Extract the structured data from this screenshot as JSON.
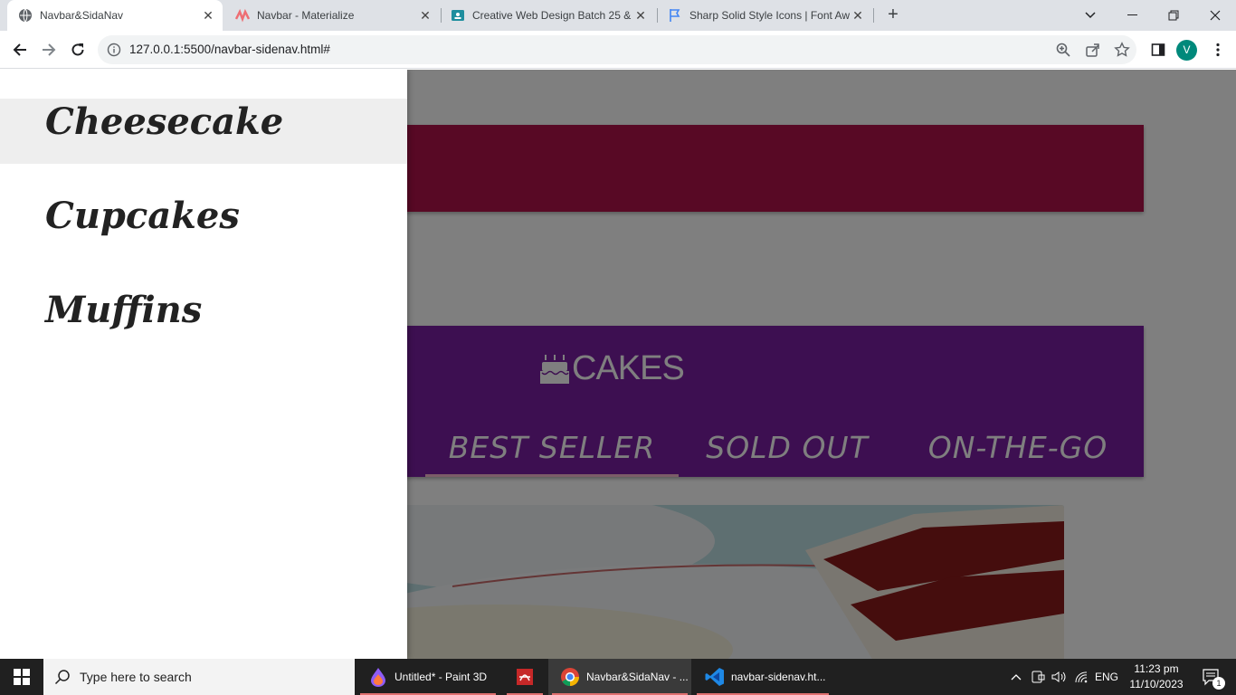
{
  "browser": {
    "tabs": [
      {
        "title": "Navbar&SidaNav",
        "favicon": "globe-icon",
        "active": true
      },
      {
        "title": "Navbar - Materialize",
        "favicon": "materialize-icon",
        "active": false
      },
      {
        "title": "Creative Web Design Batch 25 &",
        "favicon": "classroom-icon",
        "active": false
      },
      {
        "title": "Sharp Solid Style Icons | Font Aw",
        "favicon": "fontawesome-flag-icon",
        "active": false
      }
    ],
    "new_tab": "+",
    "url": "127.0.0.1:5500/navbar-sidenav.html#",
    "profile_initial": "V"
  },
  "page": {
    "brand": "CAKES",
    "brand_icon": "birthday-cake-icon",
    "nav_tabs": [
      {
        "label": "BEST SELLER",
        "active": true
      },
      {
        "label": "SOLD OUT",
        "active": false
      },
      {
        "label": "ON-THE-GO",
        "active": false
      }
    ],
    "colors": {
      "top_bar": "#b0124a",
      "nav_bar": "#7b1fa2",
      "overlay": "rgba(0,0,0,0.5)"
    }
  },
  "sidenav": {
    "items": [
      {
        "label": "Cheesecake",
        "hovered": true
      },
      {
        "label": "Cupcakes",
        "hovered": false
      },
      {
        "label": "Muffins",
        "hovered": false
      }
    ]
  },
  "taskbar": {
    "search_placeholder": "Type here to search",
    "apps": [
      {
        "label": "Untitled* - Paint 3D",
        "icon": "paint3d-icon"
      },
      {
        "label": "",
        "icon": "pdf-app-icon"
      },
      {
        "label": "Navbar&SidaNav - ...",
        "icon": "chrome-icon"
      },
      {
        "label": "navbar-sidenav.ht...",
        "icon": "vscode-icon"
      }
    ],
    "language": "ENG",
    "time": "11:23 pm",
    "date": "11/10/2023",
    "notification_count": "1"
  }
}
